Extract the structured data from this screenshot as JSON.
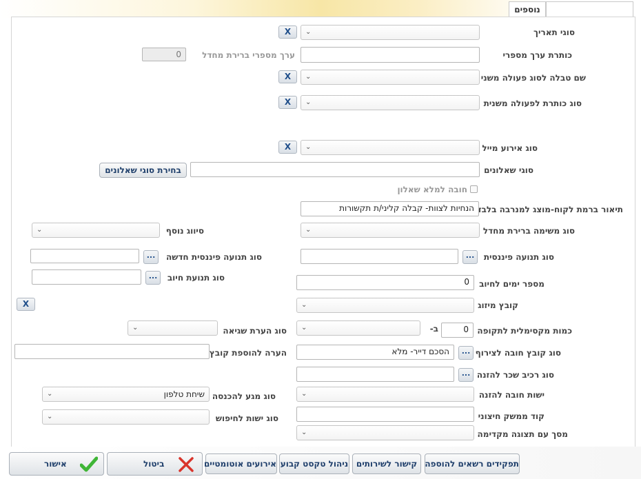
{
  "tabs": {
    "active": "נוספים"
  },
  "rows": {
    "date_type": {
      "label": "סוגי תאריך",
      "value": ""
    },
    "numeric_title": {
      "label": "כותרת ערך מספרי",
      "value": ""
    },
    "numeric_default": {
      "label": "ערך מספרי ברירת מחדל",
      "value": "0"
    },
    "secondary_table": {
      "label": "שם טבלה לסוג פעולה משני",
      "value": ""
    },
    "secondary_title": {
      "label": "סוג כותרת לפעולה משנית",
      "value": ""
    },
    "mail_event": {
      "label": "סוג אירוע מייל",
      "value": ""
    },
    "questionnaires": {
      "label": "סוגי שאלונים",
      "value": "",
      "button": "בחירת סוגי שאלונים"
    },
    "must_fill": {
      "label": "חובה למלא שאלון",
      "checked": false
    },
    "description": {
      "label": "תיאור ברמת לקוח-מוצג למנרבה בלבד",
      "value": "הנחיות לצוות- קבלה קליני/ת תקשורות"
    },
    "task_type": {
      "label": "סוג משימה ברירת מחדל",
      "value": ""
    },
    "extra_class": {
      "label": "סיווג נוסף",
      "value": ""
    },
    "fin_type": {
      "label": "סוג תנועה פיננסית",
      "value": ""
    },
    "fin_type_new": {
      "label": "סוג תנועה פיננסית חדשה",
      "value": ""
    },
    "charge_type": {
      "label": "סוג תנועת חיוב",
      "value": ""
    },
    "days_to_charge": {
      "label": "מספר ימים לחיוב",
      "value": "0"
    },
    "merge_file": {
      "label": "קובץ מיזוג",
      "value": ""
    },
    "max_qty": {
      "label": "כמות מקסימלית לתקופה",
      "value": "0",
      "in": "ב-",
      "period": ""
    },
    "error_note": {
      "label": "סוג הערת שגיאה",
      "value": ""
    },
    "attach_type": {
      "label": "סוג קובץ חובה לצירוף",
      "value": "הסכם דייר- מלא"
    },
    "file_note": {
      "label": "הערה להוספת קובץ",
      "value": ""
    },
    "wage_component": {
      "label": "סוג רכיב שכר להזנה",
      "value": ""
    },
    "mandatory_entity": {
      "label": "ישות חובה להזנה",
      "value": ""
    },
    "entry_contact": {
      "label": "סוג מגע להכנסה",
      "value": "שיחת טלפון"
    },
    "external_code": {
      "label": "קוד ממשק חיצוני",
      "value": ""
    },
    "search_entity": {
      "label": "סוג ישות לחיפוש",
      "value": ""
    },
    "preview_screen": {
      "label": "מסך עם תצוגה מקדימה",
      "value": ""
    }
  },
  "buttons": {
    "x": "X",
    "dots": "...",
    "ok": "אישור",
    "cancel": "ביטול",
    "auto_events": "אירועים אוטומטיים",
    "fixed_text": "ניהול טקסט קבוע",
    "services_link": "קישור לשירותים",
    "roles": "תפקידים רשאים להוספה"
  },
  "colors": {
    "accent": "#1f4e8a",
    "check_green": "#3fb536",
    "cancel_red": "#d9342b"
  }
}
